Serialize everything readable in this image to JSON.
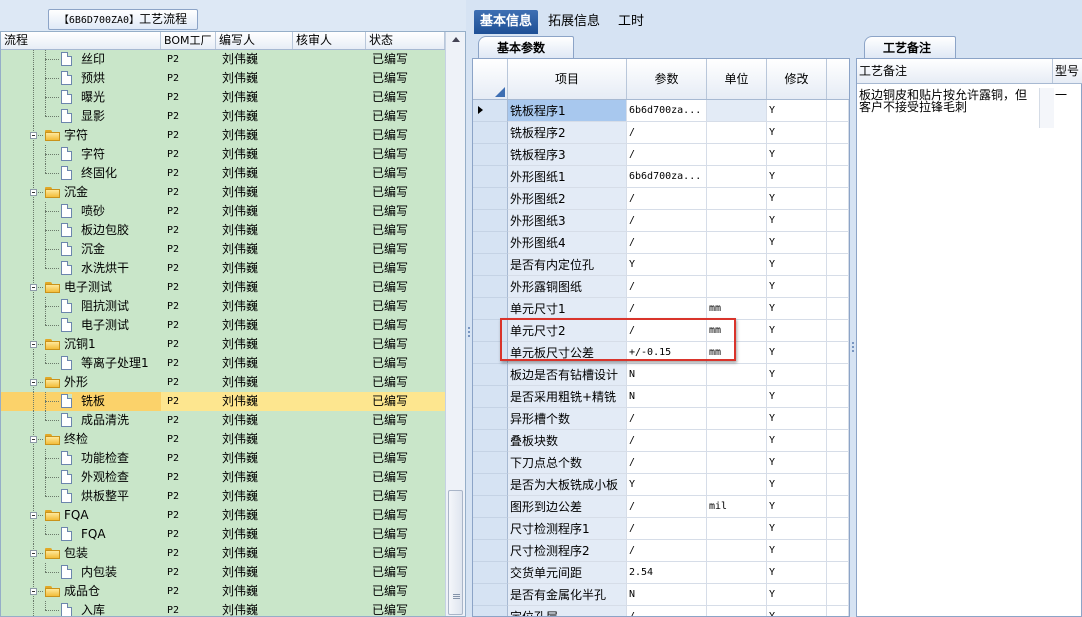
{
  "left_panel": {
    "title_code": "【6B6D700ZA0】",
    "title_text": "工艺流程",
    "columns": [
      "流程",
      "BOM工厂",
      "编写人",
      "核审人",
      "状态"
    ],
    "rows": [
      {
        "name": "丝印",
        "type": "doc",
        "bom": "P2",
        "author": "刘伟巍",
        "reviewer": "",
        "status": "已编写"
      },
      {
        "name": "预烘",
        "type": "doc",
        "bom": "P2",
        "author": "刘伟巍",
        "reviewer": "",
        "status": "已编写"
      },
      {
        "name": "曝光",
        "type": "doc",
        "bom": "P2",
        "author": "刘伟巍",
        "reviewer": "",
        "status": "已编写"
      },
      {
        "name": "显影",
        "type": "doc",
        "bom": "P2",
        "author": "刘伟巍",
        "reviewer": "",
        "status": "已编写"
      },
      {
        "name": "字符",
        "type": "folder",
        "bom": "P2",
        "author": "刘伟巍",
        "reviewer": "",
        "status": "已编写"
      },
      {
        "name": "字符",
        "type": "doc",
        "bom": "P2",
        "author": "刘伟巍",
        "reviewer": "",
        "status": "已编写"
      },
      {
        "name": "终固化",
        "type": "doc",
        "bom": "P2",
        "author": "刘伟巍",
        "reviewer": "",
        "status": "已编写"
      },
      {
        "name": "沉金",
        "type": "folder",
        "bom": "P2",
        "author": "刘伟巍",
        "reviewer": "",
        "status": "已编写"
      },
      {
        "name": "喷砂",
        "type": "doc",
        "bom": "P2",
        "author": "刘伟巍",
        "reviewer": "",
        "status": "已编写"
      },
      {
        "name": "板边包胶",
        "type": "doc",
        "bom": "P2",
        "author": "刘伟巍",
        "reviewer": "",
        "status": "已编写"
      },
      {
        "name": "沉金",
        "type": "doc",
        "bom": "P2",
        "author": "刘伟巍",
        "reviewer": "",
        "status": "已编写"
      },
      {
        "name": "水洗烘干",
        "type": "doc",
        "bom": "P2",
        "author": "刘伟巍",
        "reviewer": "",
        "status": "已编写"
      },
      {
        "name": "电子测试",
        "type": "folder",
        "bom": "P2",
        "author": "刘伟巍",
        "reviewer": "",
        "status": "已编写"
      },
      {
        "name": "阻抗测试",
        "type": "doc",
        "bom": "P2",
        "author": "刘伟巍",
        "reviewer": "",
        "status": "已编写"
      },
      {
        "name": "电子测试",
        "type": "doc",
        "bom": "P2",
        "author": "刘伟巍",
        "reviewer": "",
        "status": "已编写"
      },
      {
        "name": "沉铜1",
        "type": "folder",
        "bom": "P2",
        "author": "刘伟巍",
        "reviewer": "",
        "status": "已编写"
      },
      {
        "name": "等离子处理1",
        "type": "doc",
        "bom": "P2",
        "author": "刘伟巍",
        "reviewer": "",
        "status": "已编写"
      },
      {
        "name": "外形",
        "type": "folder",
        "bom": "P2",
        "author": "刘伟巍",
        "reviewer": "",
        "status": "已编写"
      },
      {
        "name": "铣板",
        "type": "doc",
        "bom": "P2",
        "author": "刘伟巍",
        "reviewer": "",
        "status": "已编写",
        "selected": true
      },
      {
        "name": "成品清洗",
        "type": "doc",
        "bom": "P2",
        "author": "刘伟巍",
        "reviewer": "",
        "status": "已编写"
      },
      {
        "name": "终检",
        "type": "folder",
        "bom": "P2",
        "author": "刘伟巍",
        "reviewer": "",
        "status": "已编写"
      },
      {
        "name": "功能检查",
        "type": "doc",
        "bom": "P2",
        "author": "刘伟巍",
        "reviewer": "",
        "status": "已编写"
      },
      {
        "name": "外观检查",
        "type": "doc",
        "bom": "P2",
        "author": "刘伟巍",
        "reviewer": "",
        "status": "已编写"
      },
      {
        "name": "烘板整平",
        "type": "doc",
        "bom": "P2",
        "author": "刘伟巍",
        "reviewer": "",
        "status": "已编写"
      },
      {
        "name": "FQA",
        "type": "folder",
        "bom": "P2",
        "author": "刘伟巍",
        "reviewer": "",
        "status": "已编写"
      },
      {
        "name": "FQA",
        "type": "doc",
        "bom": "P2",
        "author": "刘伟巍",
        "reviewer": "",
        "status": "已编写"
      },
      {
        "name": "包装",
        "type": "folder",
        "bom": "P2",
        "author": "刘伟巍",
        "reviewer": "",
        "status": "已编写"
      },
      {
        "name": "内包装",
        "type": "doc",
        "bom": "P2",
        "author": "刘伟巍",
        "reviewer": "",
        "status": "已编写"
      },
      {
        "name": "成品仓",
        "type": "folder",
        "bom": "P2",
        "author": "刘伟巍",
        "reviewer": "",
        "status": "已编写"
      },
      {
        "name": "入库",
        "type": "doc",
        "bom": "P2",
        "author": "刘伟巍",
        "reviewer": "",
        "status": "已编写"
      }
    ]
  },
  "tabs": [
    "基本信息",
    "拓展信息",
    "工时"
  ],
  "basic_params": {
    "tab_label": "基本参数",
    "columns": [
      "项目",
      "参数",
      "单位",
      "修改"
    ],
    "rows": [
      {
        "item": "铣板程序1",
        "param": "6b6d700za...",
        "unit": "",
        "mod": "Y"
      },
      {
        "item": "铣板程序2",
        "param": "/",
        "unit": "",
        "mod": "Y"
      },
      {
        "item": "铣板程序3",
        "param": "/",
        "unit": "",
        "mod": "Y"
      },
      {
        "item": "外形图纸1",
        "param": "6b6d700za...",
        "unit": "",
        "mod": "Y"
      },
      {
        "item": "外形图纸2",
        "param": "/",
        "unit": "",
        "mod": "Y"
      },
      {
        "item": "外形图纸3",
        "param": "/",
        "unit": "",
        "mod": "Y"
      },
      {
        "item": "外形图纸4",
        "param": "/",
        "unit": "",
        "mod": "Y"
      },
      {
        "item": "是否有内定位孔",
        "param": "Y",
        "unit": "",
        "mod": "Y"
      },
      {
        "item": "外形露铜图纸",
        "param": "/",
        "unit": "",
        "mod": "Y"
      },
      {
        "item": "单元尺寸1",
        "param": "/",
        "unit": "mm",
        "mod": "Y"
      },
      {
        "item": "单元尺寸2",
        "param": "/",
        "unit": "mm",
        "mod": "Y"
      },
      {
        "item": "单元板尺寸公差",
        "param": "+/-0.15",
        "unit": "mm",
        "mod": "Y"
      },
      {
        "item": "板边是否有钻槽设计",
        "param": "N",
        "unit": "",
        "mod": "Y"
      },
      {
        "item": "是否采用粗铣+精铣",
        "param": "N",
        "unit": "",
        "mod": "Y"
      },
      {
        "item": "异形槽个数",
        "param": "/",
        "unit": "",
        "mod": "Y"
      },
      {
        "item": "叠板块数",
        "param": "/",
        "unit": "",
        "mod": "Y"
      },
      {
        "item": "下刀点总个数",
        "param": "/",
        "unit": "",
        "mod": "Y"
      },
      {
        "item": "是否为大板铣成小板",
        "param": "Y",
        "unit": "",
        "mod": "Y"
      },
      {
        "item": "图形到边公差",
        "param": "/",
        "unit": "mil",
        "mod": "Y"
      },
      {
        "item": "尺寸检测程序1",
        "param": "/",
        "unit": "",
        "mod": "Y"
      },
      {
        "item": "尺寸检测程序2",
        "param": "/",
        "unit": "",
        "mod": "Y"
      },
      {
        "item": "交货单元间距",
        "param": "2.54",
        "unit": "",
        "mod": "Y"
      },
      {
        "item": "是否有金属化半孔",
        "param": "N",
        "unit": "",
        "mod": "Y"
      },
      {
        "item": "定位孔层",
        "param": "/",
        "unit": "",
        "mod": "Y"
      }
    ]
  },
  "notes_panel": {
    "tab_label": "工艺备注",
    "columns": [
      "工艺备注",
      "型号一"
    ],
    "note_line1": "板边铜皮和贴片按允许露铜，但",
    "note_line2": "客户不接受拉锋毛刺"
  },
  "colors": {
    "tree_bg": "#c9e6c9",
    "selected_row": "#fde68f",
    "active_tab": "#2a5ea5",
    "highlight_box": "#d9342b"
  }
}
